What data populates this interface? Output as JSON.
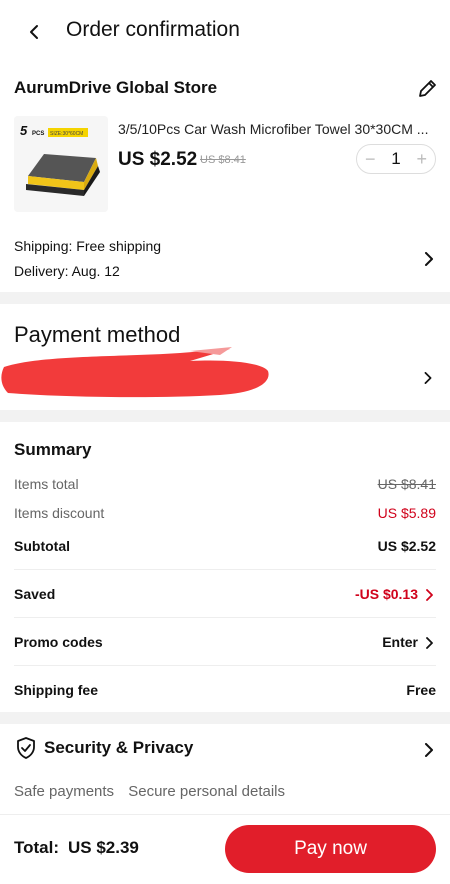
{
  "header": {
    "title": "Order confirmation",
    "back_icon": "chevron-left-icon"
  },
  "store": {
    "name": "AurumDrive Global Store",
    "edit_icon": "pencil-icon"
  },
  "product": {
    "name": "3/5/10Pcs Car Wash Microfiber Towel 30*30CM ...",
    "price": "US $2.52",
    "old_price": "US $8.41",
    "quantity": "1",
    "minus": "−",
    "plus": "+",
    "thumb_badge": "5",
    "thumb_pcs": "PCS",
    "thumb_size": "SIZE:30*60CM"
  },
  "shipping": {
    "shipping_text": "Shipping: Free shipping",
    "delivery_text": "Delivery: Aug. 12"
  },
  "payment": {
    "title": "Payment method",
    "redacted": true
  },
  "summary": {
    "title": "Summary",
    "items_total_label": "Items total",
    "items_total_value": "US $8.41",
    "items_discount_label": "Items discount",
    "items_discount_value": "US $5.89",
    "subtotal_label": "Subtotal",
    "subtotal_value": "US $2.52",
    "saved_label": "Saved",
    "saved_value": "-US $0.13",
    "promo_label": "Promo codes",
    "promo_value": "Enter",
    "shipping_fee_label": "Shipping fee",
    "shipping_fee_value": "Free"
  },
  "security": {
    "title": "Security & Privacy",
    "items": [
      "Safe payments",
      "Secure personal details"
    ]
  },
  "footer": {
    "total_label": "Total:",
    "total_value": "US $2.39",
    "pay_button": "Pay now"
  },
  "colors": {
    "accent": "#e11e2a",
    "discount_red": "#d0021b",
    "divider": "#f2f2f2"
  }
}
